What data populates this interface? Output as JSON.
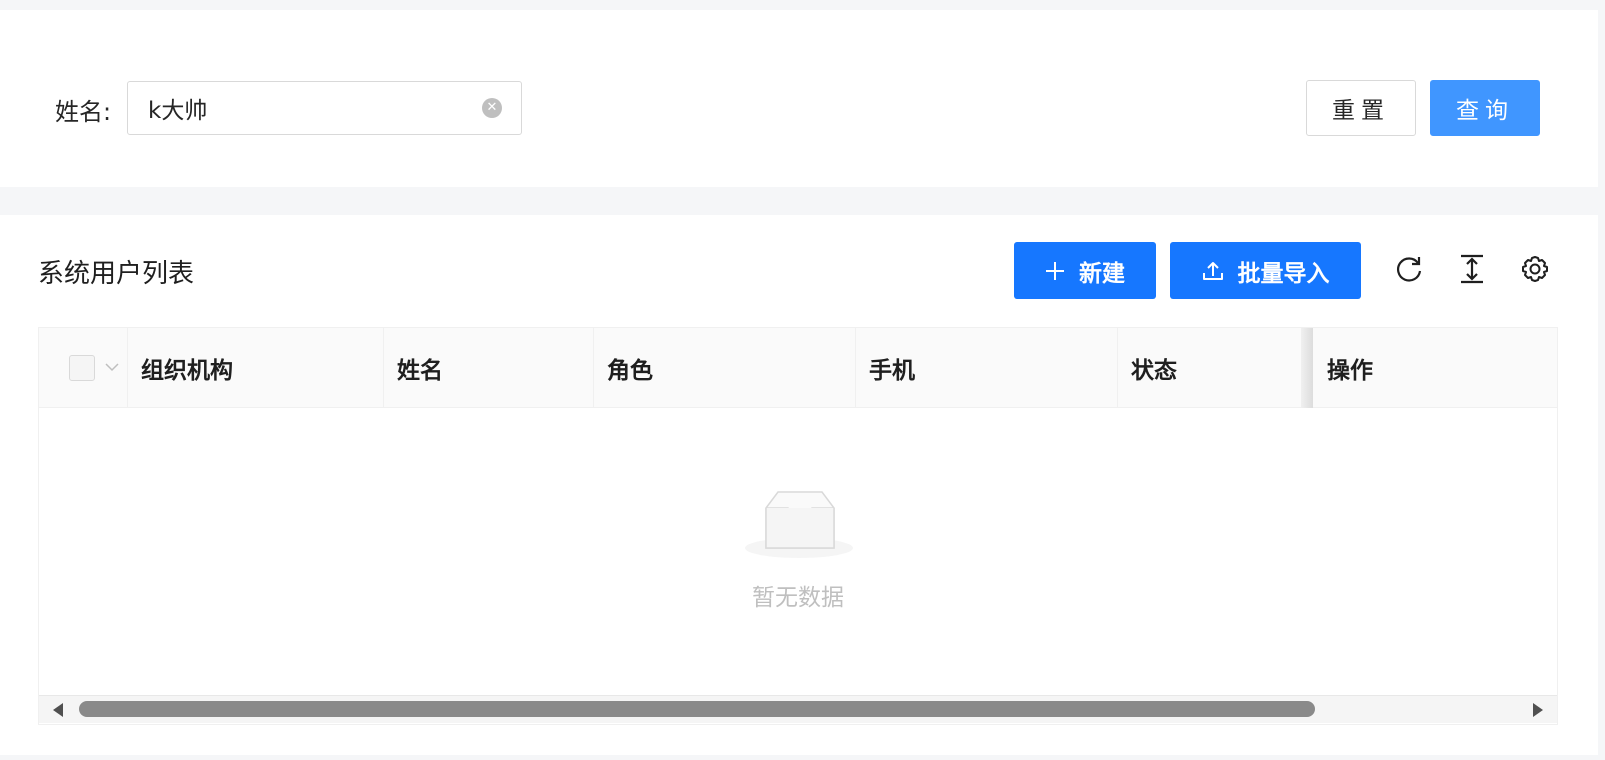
{
  "search": {
    "name_label": "姓名:",
    "name_value": "k大帅",
    "clear_glyph": "✕",
    "reset_label": "重置",
    "query_label": "查询"
  },
  "table": {
    "title": "系统用户列表",
    "new_label": "新建",
    "import_label": "批量导入",
    "columns": [
      "组织机构",
      "姓名",
      "角色",
      "手机",
      "状态",
      "操作"
    ],
    "empty_text": "暂无数据"
  },
  "colors": {
    "primary": "#1677ff",
    "query": "#4096ff",
    "border": "#d9d9d9",
    "empty_text": "#bfbfbf"
  },
  "icons": {
    "clear": "close-circle-icon",
    "new": "plus-icon",
    "import": "upload-icon",
    "refresh": "reload-icon",
    "density": "column-height-icon",
    "setting": "gear-icon",
    "empty": "inbox-icon"
  }
}
